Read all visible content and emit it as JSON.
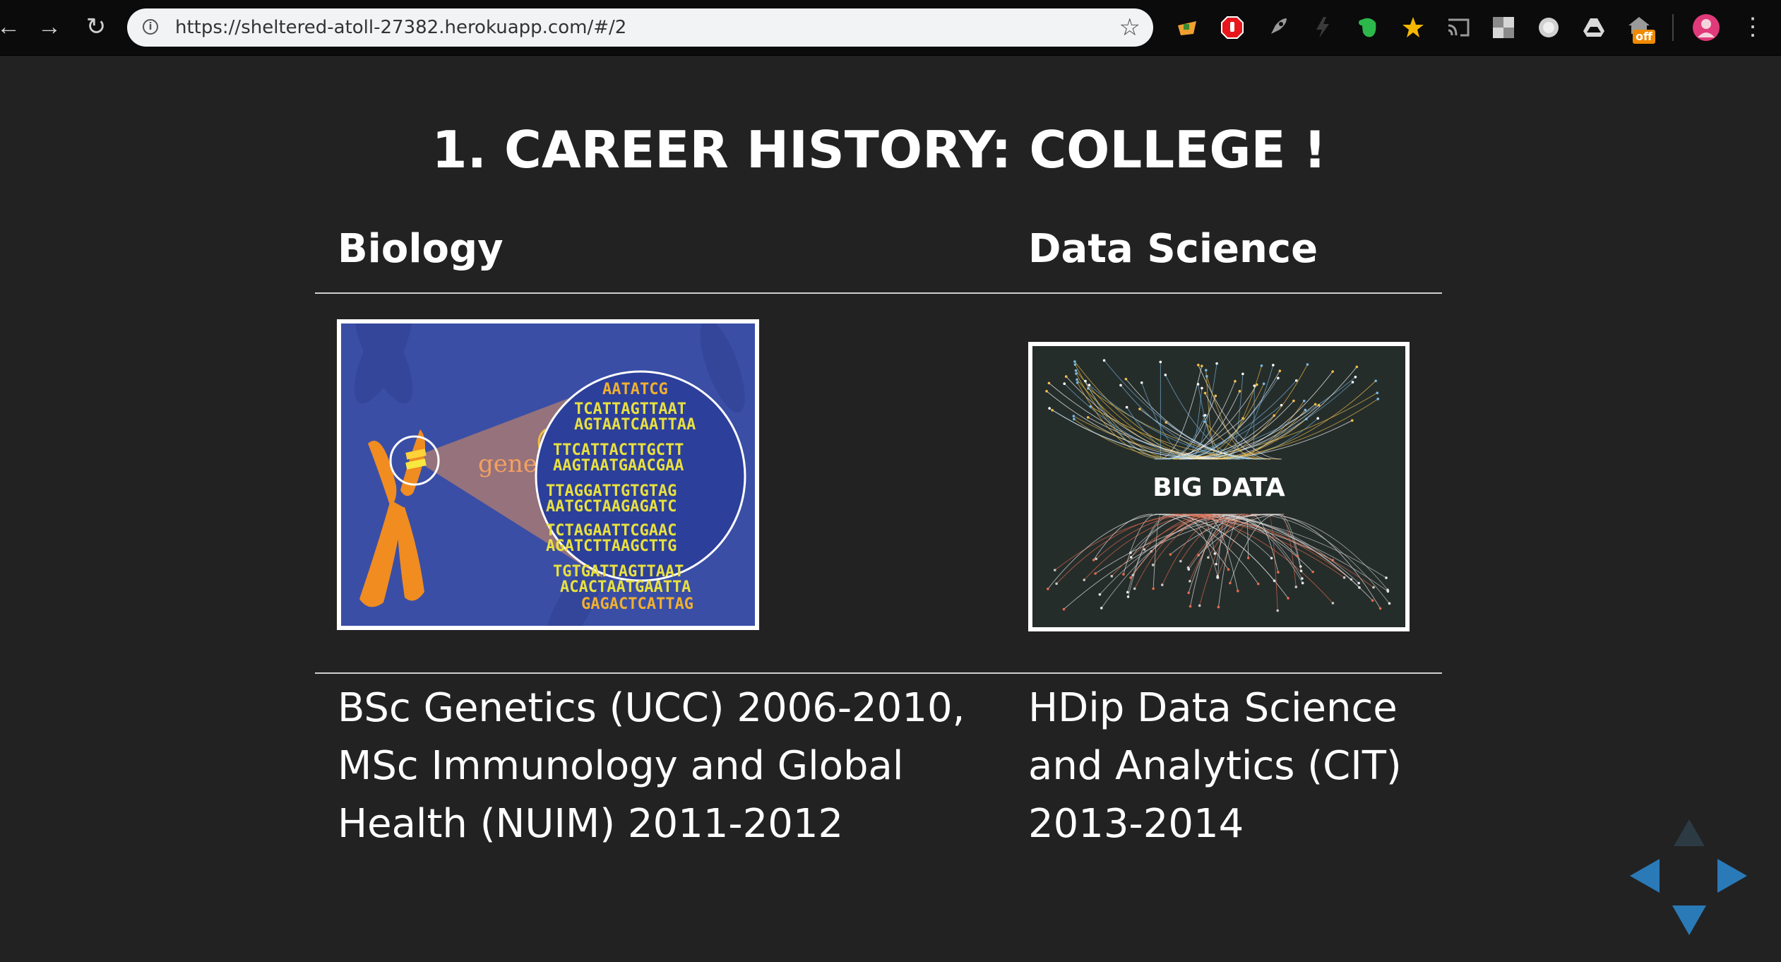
{
  "browser": {
    "url": "https://sheltered-atoll-27382.herokuapp.com/#/2",
    "ext_badge": "off"
  },
  "slide": {
    "title": "1. CAREER HISTORY: COLLEGE !",
    "columns": [
      {
        "heading": "Biology",
        "image_label": "gene",
        "lines": [
          "BSc Genetics (UCC) 2006-2010,",
          "MSc Immunology and Global",
          "Health (NUIM) 2011-2012"
        ]
      },
      {
        "heading": "Data Science",
        "image_label": "BIG DATA",
        "lines": [
          "HDip Data Science",
          "and Analytics (CIT)",
          "2013-2014"
        ]
      }
    ]
  },
  "colors": {
    "background": "#222222",
    "nav_arrow": "#2a7ab8",
    "nav_arrow_disabled": "#2c3a44"
  }
}
